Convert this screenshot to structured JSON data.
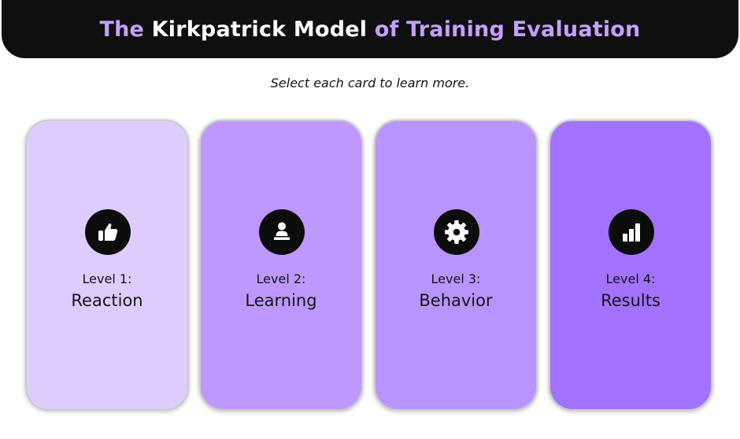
{
  "header": {
    "title_part1": "The ",
    "title_part2": "Kirkpatrick Model",
    "title_part3": " of Training Evaluation"
  },
  "instructions": "Select each card to learn more.",
  "colors": {
    "header_bg": "#0f0f0f",
    "title_accent": "#c4a1ff",
    "title_white": "#ffffff",
    "card_1": "#dfccff",
    "card_2": "#be98fe",
    "card_3": "#b894fe",
    "card_4": "#a372fe",
    "icon_circle": "#0c0c0c"
  },
  "cards": [
    {
      "level": "Level 1:",
      "name": "Reaction",
      "icon": "thumbs-up-icon"
    },
    {
      "level": "Level 2:",
      "name": "Learning",
      "icon": "learner-at-desk-icon"
    },
    {
      "level": "Level 3:",
      "name": "Behavior",
      "icon": "gear-icon"
    },
    {
      "level": "Level 4:",
      "name": "Results",
      "icon": "bar-chart-icon"
    }
  ]
}
